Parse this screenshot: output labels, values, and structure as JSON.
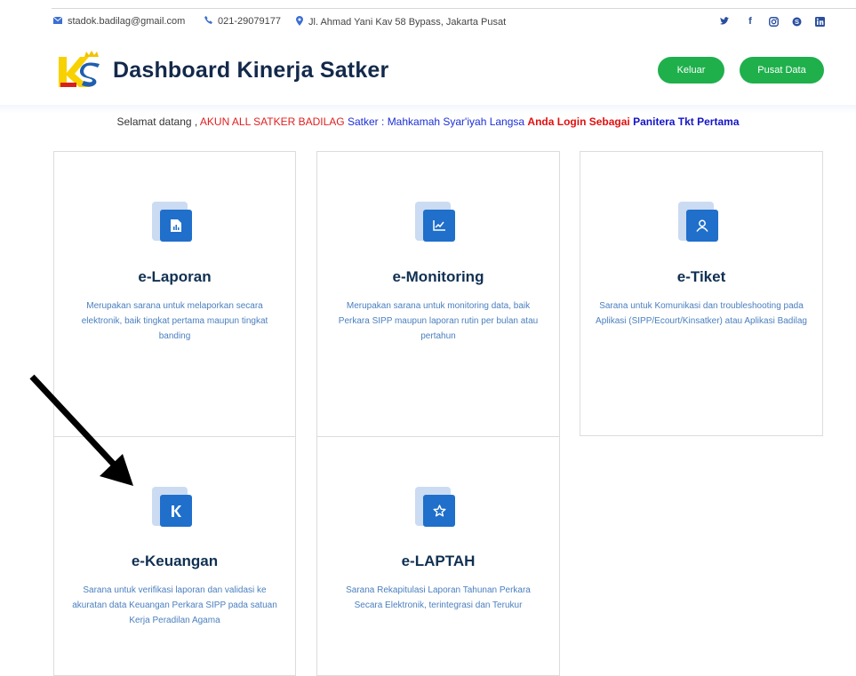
{
  "topbar": {
    "email": "stadok.badilag@gmail.com",
    "phone": "021-29079177",
    "address": "Jl. Ahmad Yani Kav 58 Bypass, Jakarta Pusat",
    "email_icon": "envelope-icon",
    "phone_icon": "phone-icon",
    "address_icon": "map-pin-icon",
    "social": [
      "twitter-icon",
      "facebook-icon",
      "instagram-icon",
      "skype-icon",
      "linkedin-icon"
    ]
  },
  "header": {
    "title": "Dashboard Kinerja Satker",
    "logout_label": "Keluar",
    "pusat_data_label": "Pusat Data"
  },
  "welcome": {
    "greeting": "Selamat datang ,",
    "account": "AKUN ALL SATKER BADILAG",
    "satker_label": "Satker :",
    "satker_name": "Mahkamah Syar'iyah Langsa",
    "login_as": "Anda Login Sebagai",
    "role": "Panitera Tkt Pertama"
  },
  "cards": [
    {
      "title": "e-Laporan",
      "desc": "Merupakan sarana untuk melaporkan secara elektronik, baik tingkat pertama maupun tingkat banding",
      "icon": "report-file-icon"
    },
    {
      "title": "e-Monitoring",
      "desc": "Merupakan sarana untuk monitoring data, baik Perkara SIPP maupun laporan rutin per bulan atau pertahun",
      "icon": "line-chart-icon"
    },
    {
      "title": "e-Tiket",
      "desc": "Sarana untuk Komunikasi dan troubleshooting pada Aplikasi (SIPP/Ecourt/Kinsatker) atau Aplikasi Badilag",
      "icon": "user-icon"
    },
    {
      "title": "e-Keuangan",
      "desc": "Sarana untuk verifikasi laporan dan validasi ke akuratan data Keuangan Perkara SIPP pada satuan Kerja Peradilan Agama",
      "icon": "k-letter-icon"
    },
    {
      "title": "e-LAPTAH",
      "desc": "Sarana Rekapitulasi Laporan Tahunan Perkara Secara Elektronik, terintegrasi dan Terukur",
      "icon": "star-icon"
    }
  ],
  "colors": {
    "accent_blue": "#1f6fcb",
    "button_green": "#1fb04c",
    "title_navy": "#13294b"
  }
}
